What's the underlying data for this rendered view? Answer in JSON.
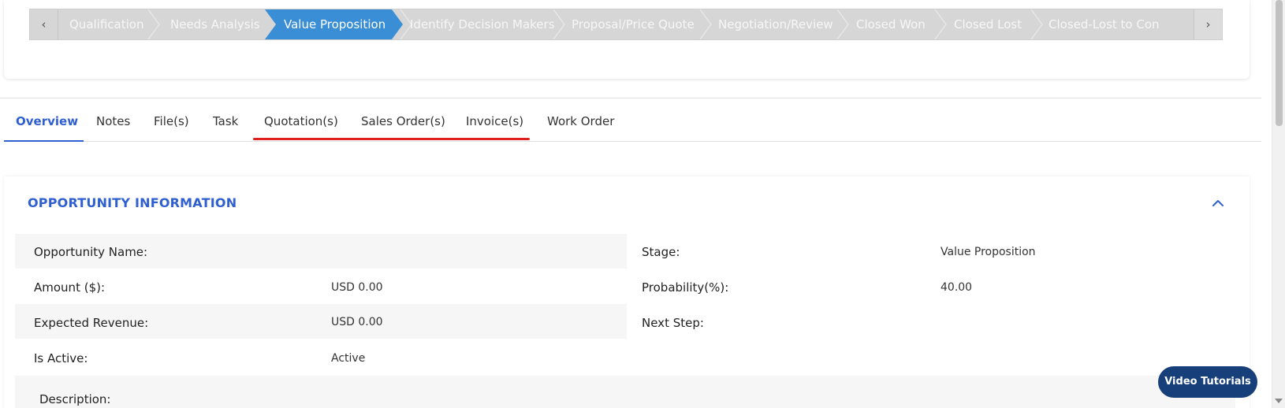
{
  "stepper": {
    "prev_icon": "chevron-left-icon",
    "next_icon": "chevron-right-icon",
    "prev_label": "‹",
    "next_label": "›",
    "steps": [
      {
        "label": "Qualification"
      },
      {
        "label": "Needs Analysis"
      },
      {
        "label": "Value Proposition",
        "active": true
      },
      {
        "label": "Identify Decision Makers"
      },
      {
        "label": "Proposal/Price Quote"
      },
      {
        "label": "Negotiation/Review"
      },
      {
        "label": "Closed Won"
      },
      {
        "label": "Closed Lost"
      },
      {
        "label": "Closed-Lost to Con"
      }
    ],
    "active_color": "#3a8ed6",
    "inactive_color": "#d6d6d6"
  },
  "tabs": [
    {
      "label": "Overview",
      "active": true
    },
    {
      "label": "Notes"
    },
    {
      "label": "File(s)"
    },
    {
      "label": "Task"
    },
    {
      "label": "Quotation(s)"
    },
    {
      "label": "Sales Order(s)"
    },
    {
      "label": "Invoice(s)"
    },
    {
      "label": "Work Order"
    }
  ],
  "section": {
    "title": "OPPORTUNITY INFORMATION",
    "collapse_icon": "chevron-up-icon",
    "fields": {
      "opportunity_name_label": "Opportunity Name:",
      "opportunity_name_value": "",
      "amount_label": "Amount ($):",
      "amount_value": "USD 0.00",
      "expected_revenue_label": "Expected Revenue:",
      "expected_revenue_value": "USD 0.00",
      "is_active_label": "Is Active:",
      "is_active_value": "Active",
      "description_label": "Description:",
      "stage_label": "Stage:",
      "stage_value": "Value Proposition",
      "probability_label": "Probability(%):",
      "probability_value": "40.00",
      "next_step_label": "Next Step:",
      "next_step_value": ""
    }
  },
  "video_tutorials": {
    "label": "Video Tutorials"
  },
  "colors": {
    "accent": "#2f5fd0",
    "highlight_underline": "#e01f1f",
    "video_button": "#173f7a"
  }
}
